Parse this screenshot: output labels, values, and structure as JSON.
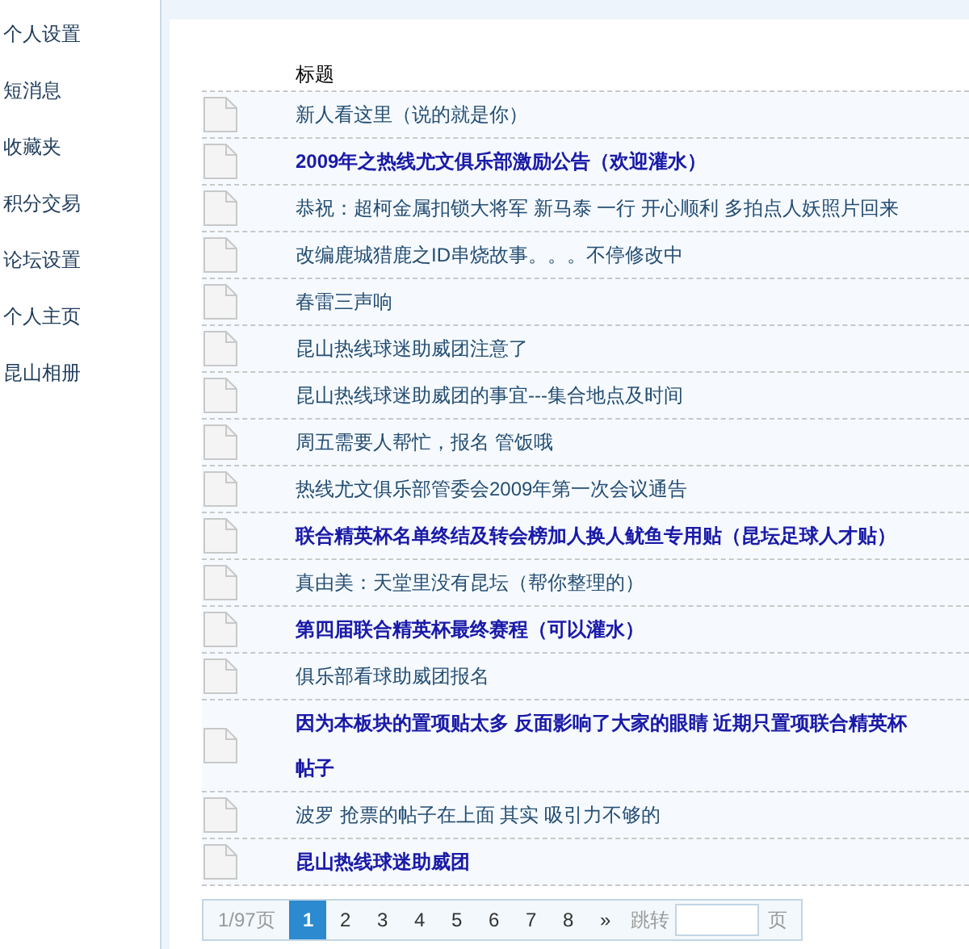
{
  "sidebar": {
    "items": [
      {
        "label": "个人设置"
      },
      {
        "label": "短消息"
      },
      {
        "label": "收藏夹"
      },
      {
        "label": "积分交易"
      },
      {
        "label": "论坛设置"
      },
      {
        "label": "个人主页"
      },
      {
        "label": "昆山相册"
      }
    ]
  },
  "table": {
    "columns": [
      "标题"
    ],
    "rows": [
      {
        "title": "新人看这里（说的就是你）",
        "bold": false
      },
      {
        "title": "2009年之热线尤文俱乐部激励公告（欢迎灌水）",
        "bold": true
      },
      {
        "title": "恭祝：超柯金属扣锁大将军 新马泰 一行 开心顺利 多拍点人妖照片回来",
        "bold": false
      },
      {
        "title": "改编鹿城猎鹿之ID串烧故事。。。不停修改中",
        "bold": false
      },
      {
        "title": "春雷三声响",
        "bold": false
      },
      {
        "title": "昆山热线球迷助威团注意了",
        "bold": false
      },
      {
        "title": "昆山热线球迷助威团的事宜---集合地点及时间",
        "bold": false
      },
      {
        "title": "周五需要人帮忙，报名 管饭哦",
        "bold": false
      },
      {
        "title": "热线尤文俱乐部管委会2009年第一次会议通告",
        "bold": false
      },
      {
        "title": "联合精英杯名单终结及转会榜加人换人鱿鱼专用贴（昆坛足球人才贴）",
        "bold": true
      },
      {
        "title": "真由美：天堂里没有昆坛（帮你整理的）",
        "bold": false
      },
      {
        "title": "第四届联合精英杯最终赛程（可以灌水）",
        "bold": true
      },
      {
        "title": "俱乐部看球助威团报名",
        "bold": false
      },
      {
        "title": "因为本板块的置项贴太多 反面影响了大家的眼睛 近期只置项联合精英杯帖子",
        "bold": true
      },
      {
        "title": "波罗 抢票的帖子在上面 其实 吸引力不够的",
        "bold": false
      },
      {
        "title": "昆山热线球迷助威团",
        "bold": true
      }
    ]
  },
  "pagination": {
    "info": "1/97页",
    "pages": [
      {
        "label": "1",
        "selected": true
      },
      {
        "label": "2",
        "selected": false
      },
      {
        "label": "3",
        "selected": false
      },
      {
        "label": "4",
        "selected": false
      },
      {
        "label": "5",
        "selected": false
      },
      {
        "label": "6",
        "selected": false
      },
      {
        "label": "7",
        "selected": false
      },
      {
        "label": "8",
        "selected": false
      }
    ],
    "next": "»",
    "jump_label": "跳转",
    "jump_suffix": "页"
  }
}
